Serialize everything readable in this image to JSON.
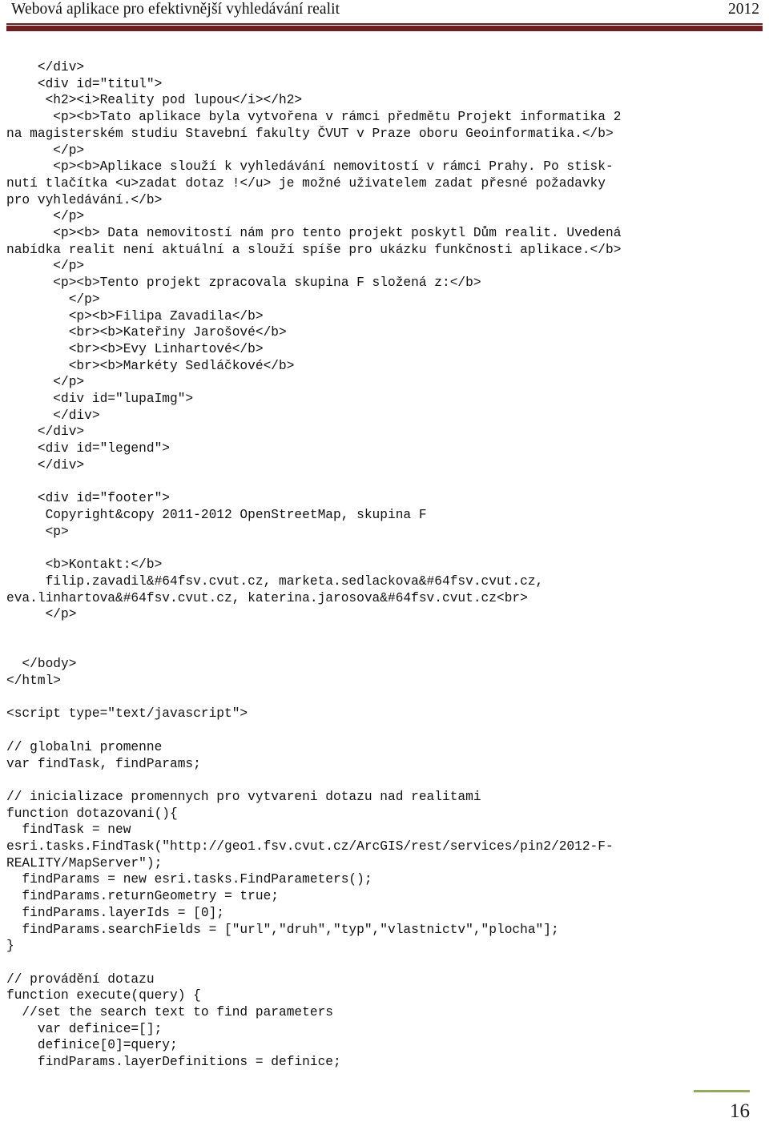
{
  "header": {
    "title": "Webová aplikace pro efektivnější vyhledávání realit",
    "year": "2012",
    "rule_color": "#6e1f1f"
  },
  "footer": {
    "page_number": "16",
    "rule_color": "#93ab5f"
  },
  "code": {
    "lines": [
      "    </div>",
      "    <div id=\"titul\">",
      "     <h2><i>Reality pod lupou</i></h2>",
      "      <p><b>Tato aplikace byla vytvořena v rámci předmětu Projekt informatika 2",
      "na magisterském studiu Stavební fakulty ČVUT v Praze oboru Geoinformatika.</b>",
      "      </p>",
      "      <p><b>Aplikace slouží k vyhledávání nemovitostí v rámci Prahy. Po stisk-",
      "nutí tlačítka <u>zadat dotaz !</u> je možné uživatelem zadat přesné požadavky",
      "pro vyhledávání.</b>",
      "      </p>",
      "      <p><b> Data nemovitostí nám pro tento projekt poskytl Dům realit. Uvedená",
      "nabídka realit není aktuální a slouží spíše pro ukázku funkčnosti aplikace.</b>",
      "      </p>",
      "      <p><b>Tento projekt zpracovala skupina F složená z:</b>",
      "        </p>",
      "        <p><b>Filipa Zavadila</b>",
      "        <br><b>Kateřiny Jarošové</b>",
      "        <br><b>Evy Linhartové</b>",
      "        <br><b>Markéty Sedláčkové</b>",
      "      </p>",
      "      <div id=\"lupaImg\">",
      "      </div>",
      "    </div>",
      "    <div id=\"legend\">",
      "    </div>",
      "",
      "    <div id=\"footer\">",
      "     Copyright&copy 2011-2012 OpenStreetMap, skupina F",
      "     <p>",
      "",
      "     <b>Kontakt:</b>",
      "     filip.zavadil&#64fsv.cvut.cz, marketa.sedlackova&#64fsv.cvut.cz,",
      "eva.linhartova&#64fsv.cvut.cz, katerina.jarosova&#64fsv.cvut.cz<br>",
      "     </p>",
      "",
      "",
      "  </body>",
      "</html>",
      "",
      "<script type=\"text/javascript\">",
      "",
      "// globalni promenne",
      "var findTask, findParams;",
      "",
      "// inicializace promennych pro vytvareni dotazu nad realitami",
      "function dotazovani(){",
      "  findTask = new",
      "esri.tasks.FindTask(\"http://geo1.fsv.cvut.cz/ArcGIS/rest/services/pin2/2012-F-",
      "REALITY/MapServer\");",
      "  findParams = new esri.tasks.FindParameters();",
      "  findParams.returnGeometry = true;",
      "  findParams.layerIds = [0];",
      "  findParams.searchFields = [\"url\",\"druh\",\"typ\",\"vlastnictv\",\"plocha\"];",
      "}",
      "",
      "// provádění dotazu",
      "function execute(query) {",
      "  //set the search text to find parameters",
      "    var definice=[];",
      "    definice[0]=query;",
      "    findParams.layerDefinitions = definice;"
    ]
  }
}
